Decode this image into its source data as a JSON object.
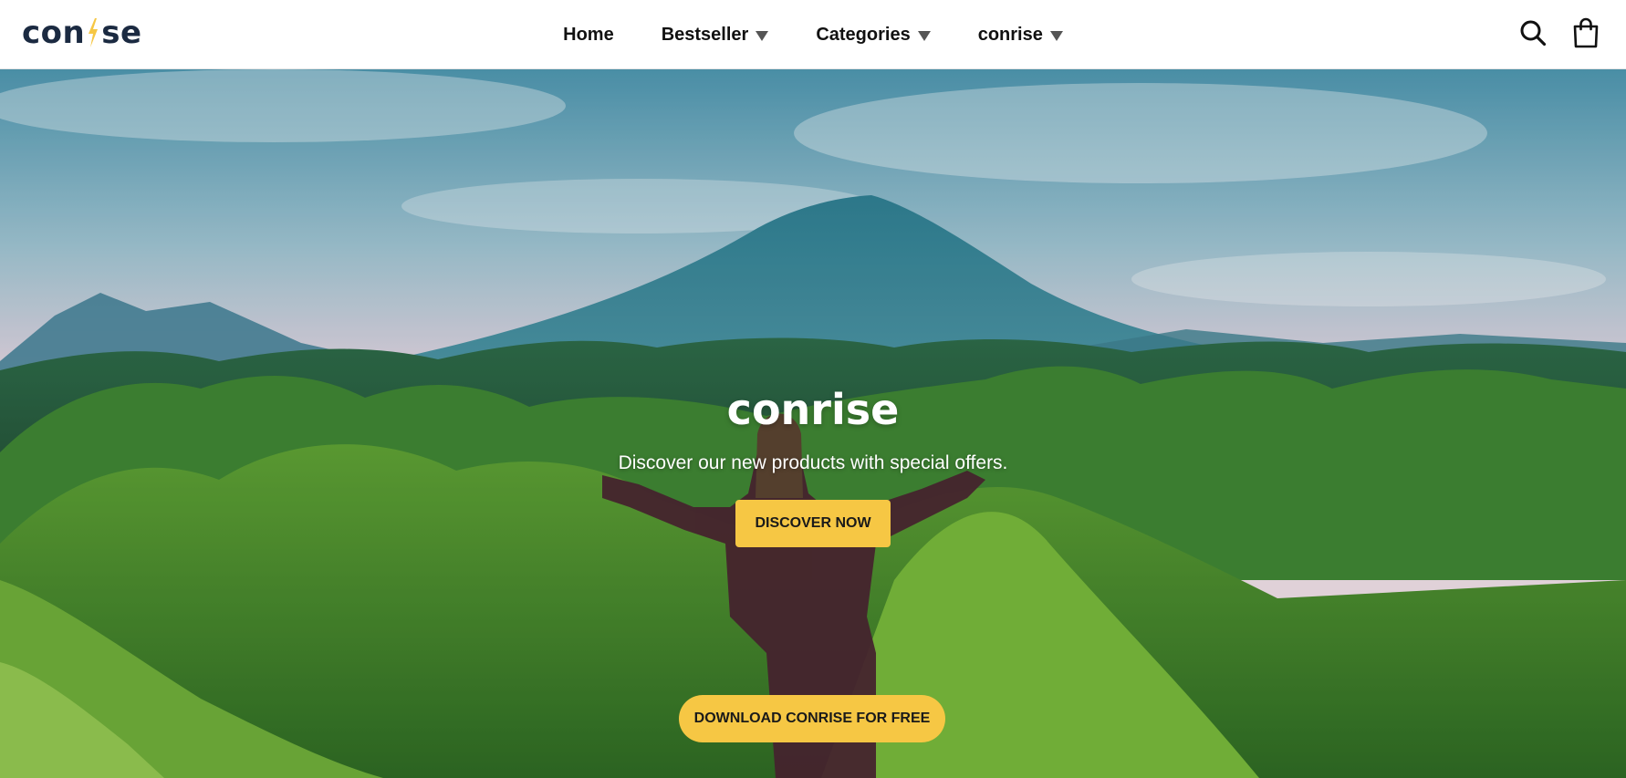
{
  "brand": {
    "logo_text_left": "con",
    "logo_text_right": "se",
    "logo_color": "#1b2a41",
    "accent_color": "#f6c744"
  },
  "nav": {
    "items": [
      {
        "label": "Home",
        "has_dropdown": false
      },
      {
        "label": "Bestseller",
        "has_dropdown": true
      },
      {
        "label": "Categories",
        "has_dropdown": true
      },
      {
        "label": "conrise",
        "has_dropdown": true
      }
    ]
  },
  "header_icons": [
    "search-icon",
    "shopping-bag-icon"
  ],
  "hero": {
    "title": "conrise",
    "subtitle": "Discover our new products with special offers.",
    "primary_button": "DISCOVER NOW",
    "secondary_button": "DOWNLOAD CONRISE FOR FREE"
  }
}
